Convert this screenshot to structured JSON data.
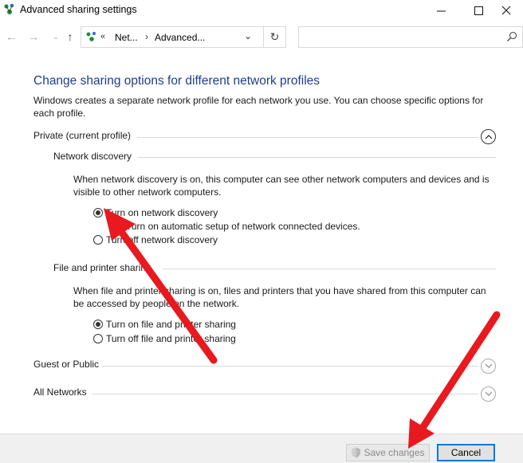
{
  "window": {
    "title": "Advanced sharing settings",
    "minimize_glyph": "—",
    "maximize_glyph": "☐",
    "close_glyph": "✕"
  },
  "nav": {
    "back_glyph": "←",
    "forward_glyph": "→",
    "recent_glyph": "⌄",
    "up_glyph": "↑",
    "address_chevron": "«",
    "breadcrumb": [
      "Net...",
      "Advanced..."
    ],
    "breadcrumb_sep": "›",
    "address_dropdown_glyph": "⌄",
    "refresh_glyph": "↻",
    "search_placeholder": ""
  },
  "content": {
    "heading": "Change sharing options for different network profiles",
    "intro": "Windows creates a separate network profile for each network you use. You can choose specific options for each profile.",
    "profiles": {
      "private": {
        "title": "Private (current profile)",
        "expanded": true,
        "network_discovery": {
          "title": "Network discovery",
          "description": "When network discovery is on, this computer can see other network computers and devices and is visible to other network computers.",
          "option_on": "Turn on network discovery",
          "option_auto_setup": "Turn on automatic setup of network connected devices.",
          "option_off": "Turn off network discovery",
          "selected": "on",
          "auto_setup_checked": true
        },
        "file_printer_sharing": {
          "title": "File and printer sharing",
          "description": "When file and printer sharing is on, files and printers that you have shared from this computer can be accessed by people on the network.",
          "option_on": "Turn on file and printer sharing",
          "option_off": "Turn off file and printer sharing",
          "selected": "on"
        }
      },
      "guest_public": {
        "title": "Guest or Public",
        "expanded": false
      },
      "all_networks": {
        "title": "All Networks",
        "expanded": false
      }
    }
  },
  "footer": {
    "save_label": "Save changes",
    "save_enabled": false,
    "cancel_label": "Cancel"
  },
  "colors": {
    "heading": "#1e3d8f",
    "annotation_arrow": "#e8191f",
    "default_button_border": "#0078d7"
  },
  "icons": {
    "app": "network-sharing-icon",
    "search": "search-icon",
    "shield": "uac-shield-icon"
  }
}
